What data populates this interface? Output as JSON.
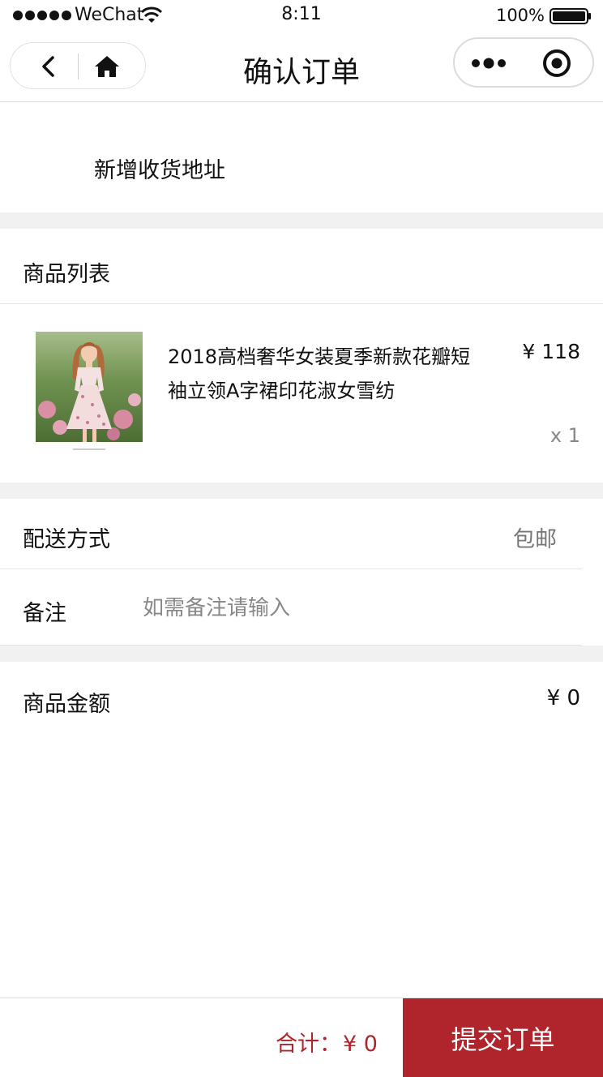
{
  "status_bar": {
    "carrier": "WeChat",
    "time": "8:11",
    "battery": "100%"
  },
  "nav": {
    "title": "确认订单",
    "icons": [
      "back-icon",
      "home-icon",
      "more-icon",
      "target-icon"
    ]
  },
  "address": {
    "label": "新增收货地址"
  },
  "goods": {
    "header": "商品列表",
    "items": [
      {
        "name": "2018高档奢华女装夏季新款花瓣短袖立领A字裙印花淑女雪纺",
        "price": "¥ 118",
        "quantity": "x 1"
      }
    ]
  },
  "delivery": {
    "label": "配送方式",
    "value": "包邮"
  },
  "note": {
    "label": "备注",
    "placeholder": "如需备注请输入"
  },
  "amount": {
    "label": "商品金额",
    "value": "¥ 0"
  },
  "footer": {
    "total_label": "合计：",
    "total_value": "¥ 0",
    "submit_label": "提交订单"
  },
  "colors": {
    "accent": "#b0242b",
    "section_gap": "#f1f1f1",
    "muted_text": "#888888"
  }
}
